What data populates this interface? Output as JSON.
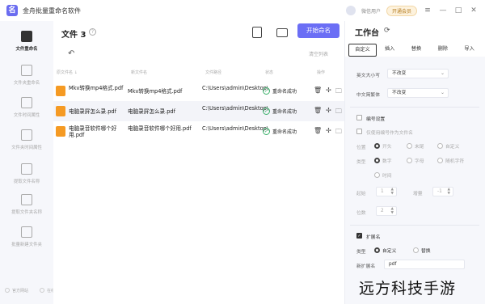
{
  "app": {
    "title": "金舟批量重命名软件",
    "user": "微信用户",
    "vip": "开通会员"
  },
  "titlebar_buttons": [
    "≡",
    "—",
    "□",
    "✕"
  ],
  "sidebar": {
    "items": [
      {
        "label": "文件重命名",
        "icon": "file-rename-icon"
      },
      {
        "label": "文件夹重命名",
        "icon": "folder-rename-icon"
      },
      {
        "label": "文件时间属性",
        "icon": "file-time-icon"
      },
      {
        "label": "文件夹时间属性",
        "icon": "folder-time-icon"
      },
      {
        "label": "提取文件名称",
        "icon": "extract-file-name-icon"
      },
      {
        "label": "提取文件夹名称",
        "icon": "extract-folder-name-icon"
      },
      {
        "label": "批量新建文件夹",
        "icon": "batch-new-folder-icon"
      }
    ],
    "footer": [
      "官方网站",
      "在线客服"
    ]
  },
  "main": {
    "title": "文件 3",
    "rename_button": "开始命名",
    "clear_list": "清空列表",
    "columns": [
      "原文件名 ↓",
      "新文件名",
      "文件路径",
      "状态",
      "操作"
    ],
    "rows": [
      {
        "original": "Mkv转换mp4格式.pdf",
        "new": "Mkv转换mp4格式.pdf",
        "path": "C:\\Users\\admin\\Desktop\\",
        "status": "重命名成功"
      },
      {
        "original": "电脑录屏怎么录.pdf",
        "new": "电脑录屏怎么录.pdf",
        "path": "C:\\Users\\admin\\Desktop\\",
        "status": "重命名成功"
      },
      {
        "original": "电脑录音软件哪个好用.pdf",
        "new": "电脑录音软件哪个好用.pdf",
        "path": "C:\\Users\\admin\\Desktop\\",
        "status": "重命名成功"
      }
    ],
    "row_ops": [
      "🗑",
      "✢",
      "🗀"
    ]
  },
  "workbench": {
    "title": "工作台",
    "tabs": [
      "自定义",
      "插入",
      "替换",
      "删除",
      "导入"
    ],
    "active_tab": "自定义",
    "case_convert": {
      "label": "英文大小写",
      "value": "不改变"
    },
    "simp_trad": {
      "label": "中文简繁体",
      "value": "不改变"
    },
    "numbering": {
      "label": "编号设置",
      "only_number_label": "仅使用编号作为文件名",
      "position_label": "位置",
      "position_options": [
        "开头",
        "末尾",
        "自定义"
      ],
      "type_label": "类型",
      "type_options": [
        "数字",
        "字母",
        "随机字符",
        "时间"
      ],
      "start_label": "起始",
      "start_value": "1",
      "step_label": "增量",
      "step_value": "-1",
      "digits_label": "位数",
      "digits_value": "2"
    },
    "extension": {
      "label": "扩展名",
      "type_label": "类型",
      "type_options": [
        "自定义",
        "替换"
      ],
      "new_ext_label": "新扩展名",
      "new_ext_value": "pdf"
    }
  },
  "watermark": "远方科技手游"
}
